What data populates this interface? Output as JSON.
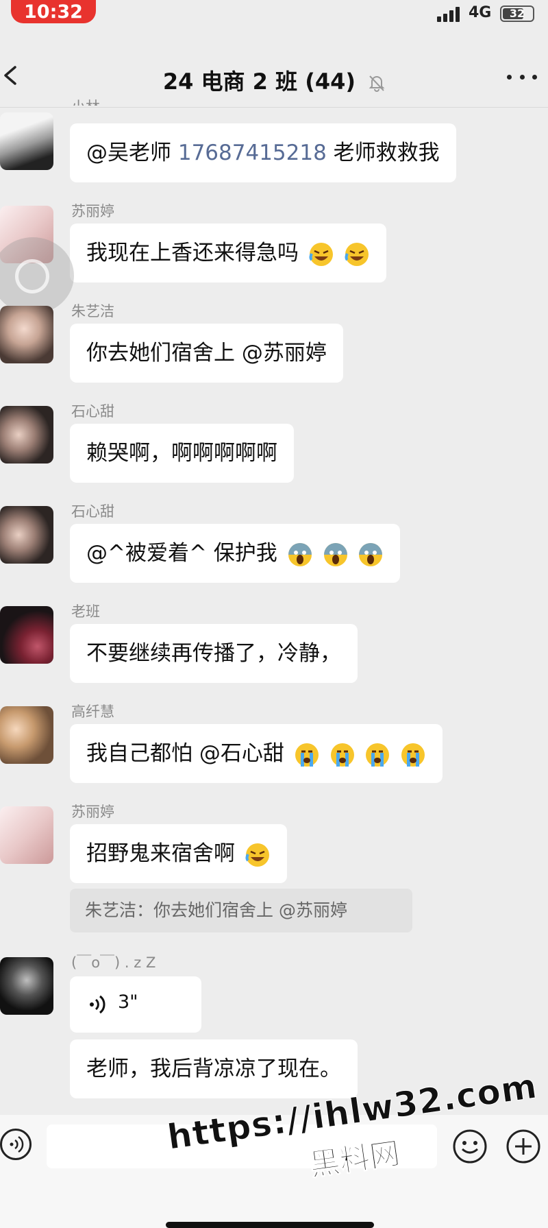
{
  "status": {
    "time": "10:32",
    "network": "4G",
    "battery": "32"
  },
  "nav": {
    "title": "24 电商 2 班 (44)"
  },
  "messages": [
    {
      "sender": "小林",
      "text_prefix": "@吴老师 ",
      "phone": "17687415218",
      "text_suffix": " 老师救救我"
    },
    {
      "sender": "苏丽婷",
      "text": "我现在上香还来得急吗",
      "emoji": [
        "laugh-cry-emoji",
        "laugh-cry-emoji"
      ]
    },
    {
      "sender": "朱艺洁",
      "text": "你去她们宿舍上 @苏丽婷"
    },
    {
      "sender": "石心甜",
      "text": "赖哭啊，啊啊啊啊啊"
    },
    {
      "sender": "石心甜",
      "text": "@^被爱着^ 保护我",
      "emoji": [
        "scream-emoji",
        "scream-emoji",
        "scream-emoji"
      ]
    },
    {
      "sender": "老班",
      "text": "不要继续再传播了，冷静，"
    },
    {
      "sender": "高纤慧",
      "text": "我自己都怕 @石心甜 ",
      "emoji": [
        "sob-emoji",
        "sob-emoji",
        "sob-emoji",
        "sob-emoji"
      ]
    },
    {
      "sender": "苏丽婷",
      "text": "招野鬼来宿舍啊",
      "emoji": [
        "laugh-cry-emoji"
      ],
      "quote": "朱艺洁：你去她们宿舍上 @苏丽婷"
    },
    {
      "sender": "(￣o￣) . z Z",
      "voice_duration": "3\"",
      "text": "老师，我后背凉凉了现在。"
    }
  ],
  "watermark": {
    "url": "https://ihlw32.com",
    "name": "黑料网"
  },
  "colors": {
    "background": "#ededed",
    "bubble": "#ffffff",
    "link": "#576b95",
    "time_pill": "#e8332e"
  }
}
